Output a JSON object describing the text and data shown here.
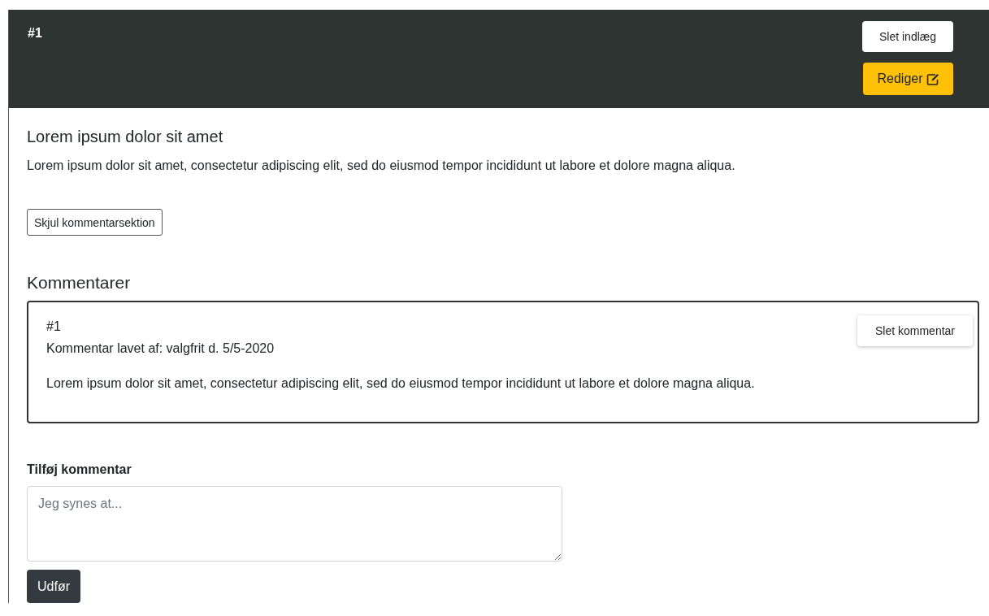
{
  "post": {
    "number": "#1",
    "buttons": {
      "delete": "Slet indlæg",
      "edit": "Rediger"
    },
    "title": "Lorem ipsum dolor sit amet",
    "body": "Lorem ipsum dolor sit amet, consectetur adipiscing elit, sed do eiusmod tempor incididunt ut labore et dolore magna aliqua.",
    "toggle_comments": "Skjul kommentarsektion"
  },
  "comments": {
    "heading": "Kommentarer",
    "items": [
      {
        "number": "#1",
        "meta": "Kommentar lavet af: valgfrit d. 5/5-2020",
        "text": "Lorem ipsum dolor sit amet, consectetur adipiscing elit, sed do eiusmod tempor incididunt ut labore et dolore magna aliqua.",
        "delete": "Slet kommentar"
      }
    ]
  },
  "form": {
    "label": "Tilføj kommentar",
    "placeholder": "Jeg synes at...",
    "submit": "Udfør"
  }
}
